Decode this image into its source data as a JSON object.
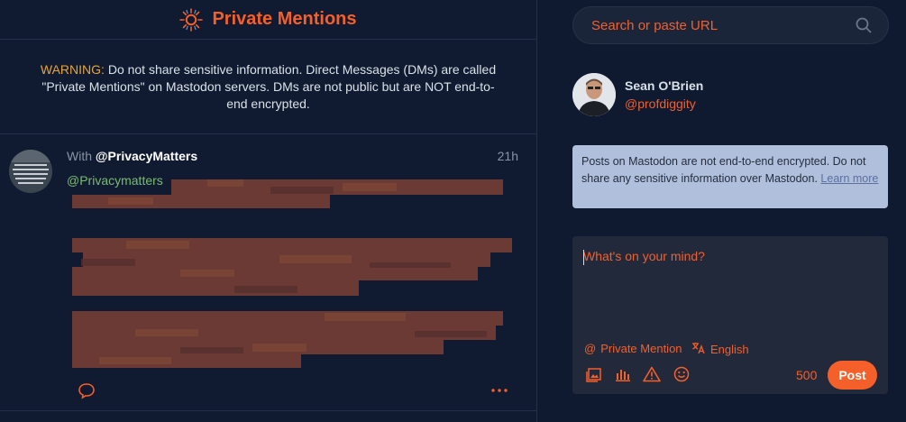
{
  "header": {
    "title": "Private Mentions",
    "icon": "at-sign-sunburst-icon"
  },
  "warning": {
    "label": "WARNING:",
    "text": " Do not share sensitive information. Direct Messages (DMs) are called \"Private Mentions\" on Mastodon servers. DMs are not public but are NOT end-to-end encrypted."
  },
  "status": {
    "with_prefix": "With",
    "with_user": "@PrivacyMatters",
    "time": "21h",
    "mention": "@Privacymatters"
  },
  "search": {
    "placeholder": "Search or paste URL"
  },
  "account": {
    "name": "Sean O'Brien",
    "handle": "@profdiggity"
  },
  "notice": {
    "text": "Posts on Mastodon are not end-to-end encrypted. Do not share any sensitive information over Mastodon. ",
    "link": "Learn more"
  },
  "compose": {
    "placeholder": "What's on your mind?",
    "privacy_label": "Private Mention",
    "language_label": "English",
    "char_count": "500",
    "post_label": "Post"
  },
  "colors": {
    "accent": "#f55f2a",
    "background": "#101a30",
    "notice_bg": "#b0c0dc"
  }
}
